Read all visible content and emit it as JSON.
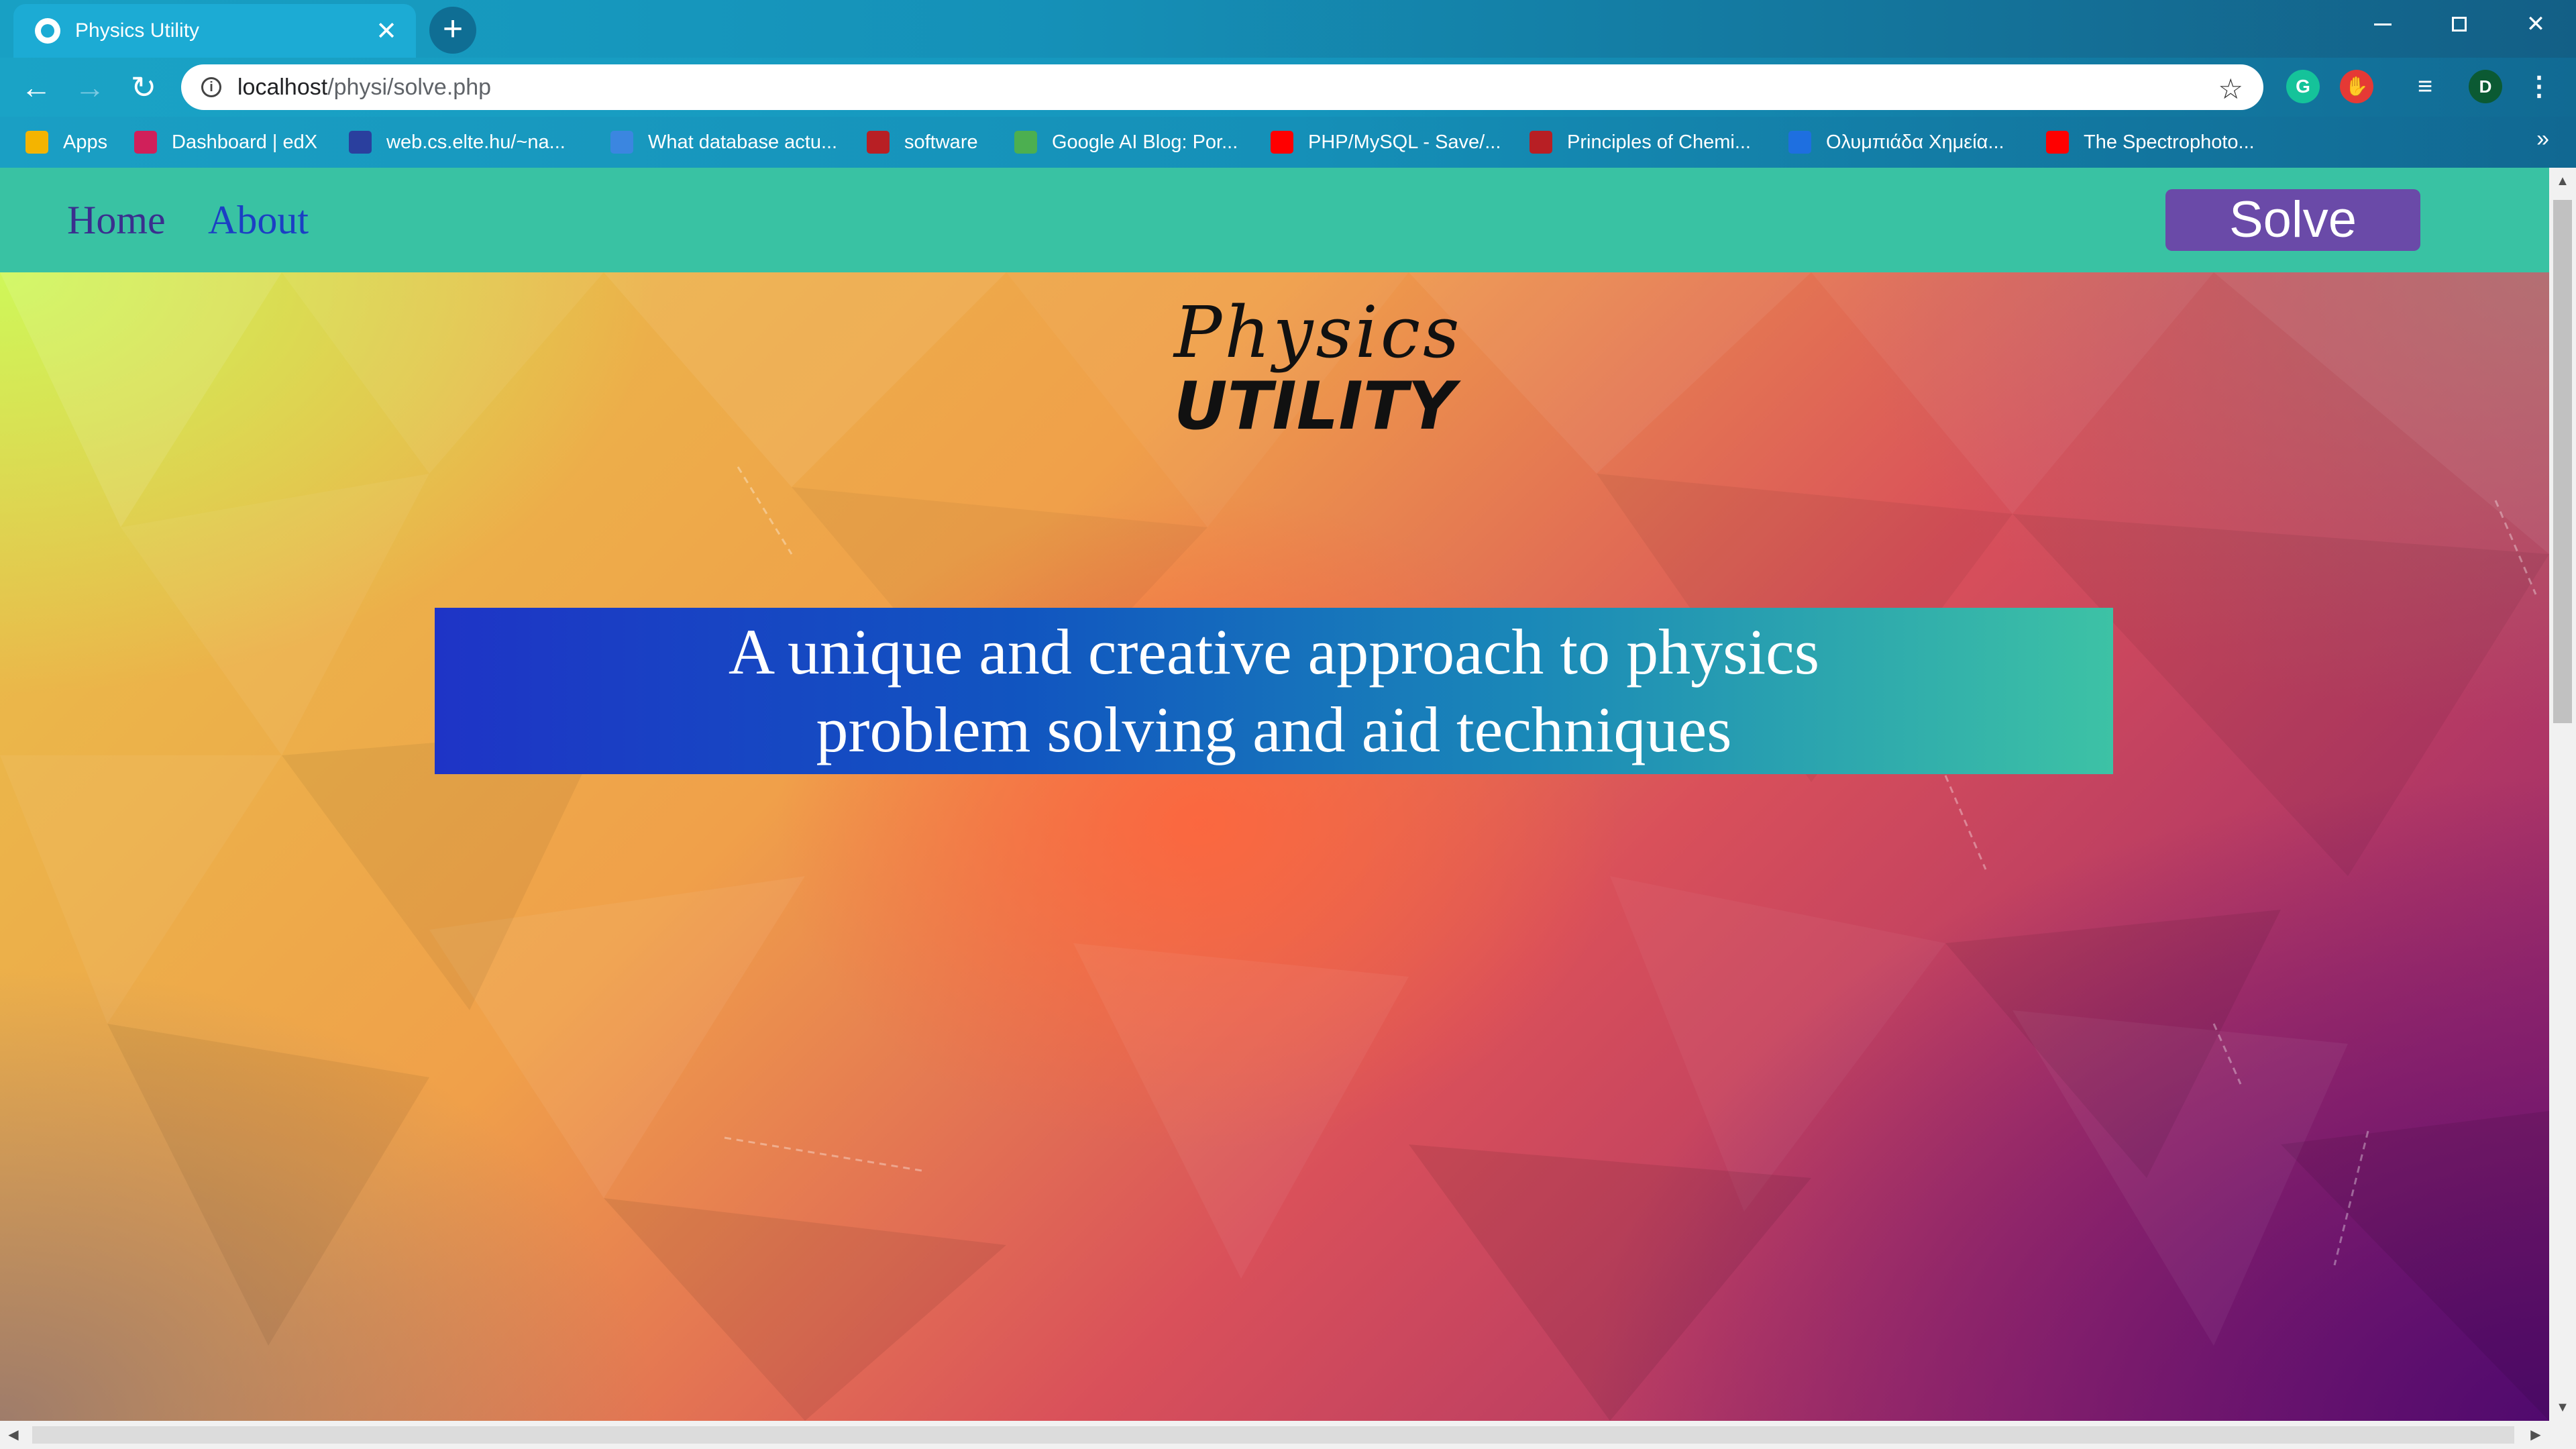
{
  "browser": {
    "tab": {
      "title": "Physics Utility",
      "close": "✕",
      "favicon": "globe-icon"
    },
    "new_tab": "+",
    "window_controls": {
      "close": "✕"
    },
    "nav": {
      "back": "←",
      "forward": "→",
      "reload": "↻"
    },
    "address": {
      "host": "localhost",
      "path": "/physi/solve.php",
      "info": "i",
      "bookmark_star": "☆"
    },
    "extensions": {
      "grammarly": "G",
      "blocker": "✋",
      "media": "≡",
      "profile": "D",
      "menu": "⋮"
    },
    "bookmarks": [
      {
        "label": "Apps",
        "color": "#f4b400"
      },
      {
        "label": "Dashboard | edX",
        "color": "#d0205a"
      },
      {
        "label": "web.cs.elte.hu/~na...",
        "color": "#2a3f9e"
      },
      {
        "label": "What database actu...",
        "color": "#3b86e0"
      },
      {
        "label": "software",
        "color": "#b81f24"
      },
      {
        "label": "Google AI Blog: Por...",
        "color": "#4caf50"
      },
      {
        "label": "PHP/MySQL - Save/...",
        "color": "#ff0000"
      },
      {
        "label": "Principles of Chemi...",
        "color": "#b81f24"
      },
      {
        "label": "Ολυμπιάδα Χημεία...",
        "color": "#1e6fe0"
      },
      {
        "label": "The Spectrophoto...",
        "color": "#ff0000"
      }
    ],
    "bookmarks_more": "»"
  },
  "page": {
    "nav": {
      "home": "Home",
      "about": "About",
      "solve": "Solve"
    },
    "logo": {
      "top": "Physics",
      "bottom": "UTILITY"
    },
    "banner": {
      "line1": "A unique and creative approach to physics",
      "line2": "problem solving and aid techniques"
    }
  },
  "scrollbars": {
    "up": "▲",
    "down": "▼",
    "left": "◀",
    "right": "▶"
  }
}
